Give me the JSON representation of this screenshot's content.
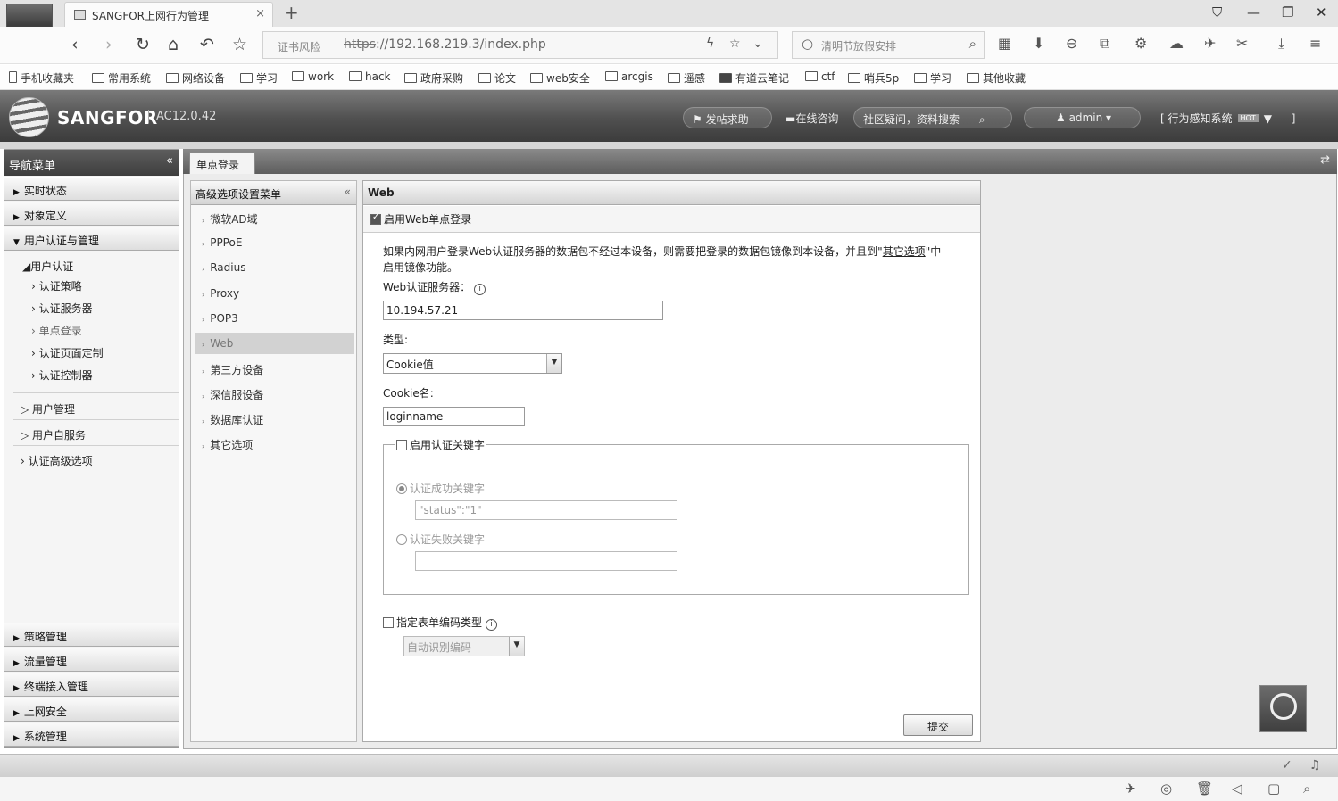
{
  "browser": {
    "tab_title": "SANGFOR上网行为管理",
    "tab_close": "×",
    "new_tab": "+",
    "risk": "证书风险",
    "url_scheme": "https",
    "url_rest": "://192.168.219.3/index.php",
    "search_placeholder": "清明节放假安排",
    "bookmarks": [
      "手机收藏夹",
      "常用系统",
      "网络设备",
      "学习",
      "work",
      "hack",
      "政府采购",
      "论文",
      "web安全",
      "arcgis",
      "遥感",
      "有道云笔记",
      "ctf",
      "哨兵5p",
      "学习",
      "其他收藏"
    ]
  },
  "header": {
    "brand": "SANGFOR",
    "version": "AC12.0.42",
    "help": "发帖求助",
    "consult": "在线咨询",
    "community": "社区疑问，资料搜索",
    "user": "admin",
    "system": "[ 行为感知系统",
    "hot": "HOT",
    "system_end": "]"
  },
  "nav": {
    "title": "导航菜单",
    "top_sections": [
      "实时状态",
      "对象定义",
      "用户认证与管理"
    ],
    "auth_group": "用户认证",
    "auth_items": [
      "认证策略",
      "认证服务器",
      "单点登录",
      "认证页面定制",
      "认证控制器"
    ],
    "sub_sections": [
      "用户管理",
      "用户自服务",
      "认证高级选项"
    ],
    "bottom_sections": [
      "策略管理",
      "流量管理",
      "终端接入管理",
      "上网安全",
      "系统管理"
    ]
  },
  "main": {
    "tab": "单点登录",
    "submenu_title": "高级选项设置菜单",
    "submenu_items": [
      "微软AD域",
      "PPPoE",
      "Radius",
      "Proxy",
      "POP3",
      "Web",
      "第三方设备",
      "深信服设备",
      "数据库认证",
      "其它选项"
    ],
    "active_item": "Web"
  },
  "web_panel": {
    "title": "Web",
    "enable_label": "启用Web单点登录",
    "desc_1": "如果内网用户登录Web认证服务器的数据包不经过本设备，则需要把登录的数据包镜像到本设备，并且到\"",
    "desc_link": "其它选项",
    "desc_2": "\"中",
    "desc_line2": "启用镜像功能。",
    "server_label": "Web认证服务器：",
    "server_value": "10.194.57.21",
    "type_label": "类型:",
    "type_value": "Cookie值",
    "cookie_label": "Cookie名:",
    "cookie_value": "loginname",
    "keyword_label": "启用认证关键字",
    "success_label": "认证成功关键字",
    "success_value": "\"status\":\"1\"",
    "fail_label": "认证失败关键字",
    "fail_value": "",
    "encoding_label": "指定表单编码类型",
    "encoding_value": "自动识别编码",
    "submit": "提交"
  },
  "colors": {
    "header_dark": "#3c3c3c",
    "nav_head": "#4a4a4a",
    "active_item": "#d2d2d2"
  }
}
